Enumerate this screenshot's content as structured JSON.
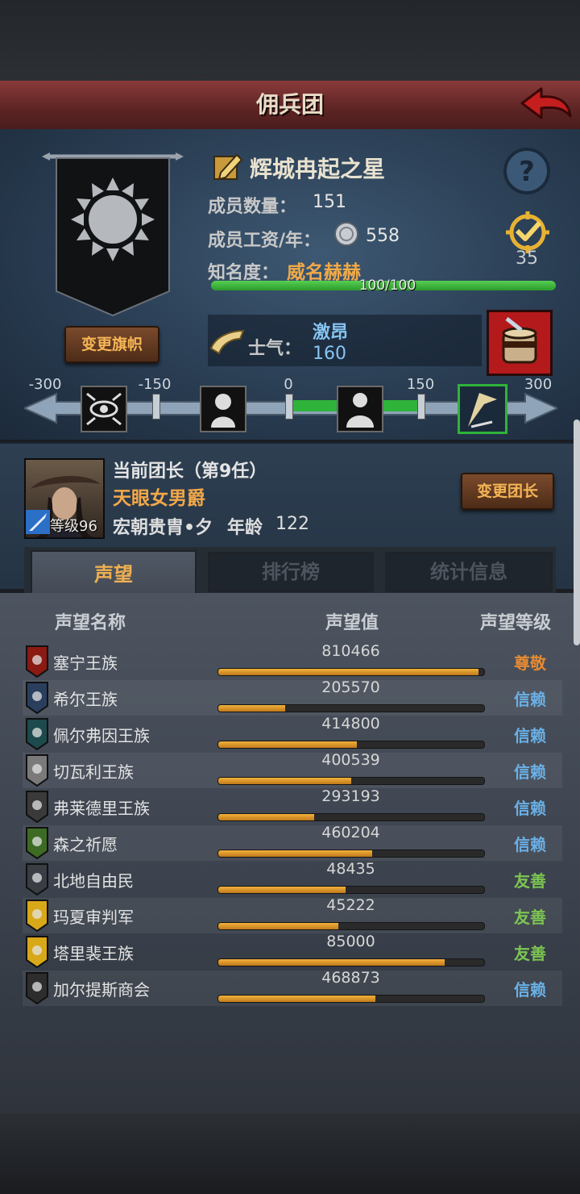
{
  "header": {
    "title": "佣兵团"
  },
  "company": {
    "name": "辉城冉起之星",
    "members_label": "成员数量：",
    "members_value": "151",
    "wage_label": "成员工资/年：",
    "wage_value": "558",
    "fame_label": "知名度：",
    "fame_value": "威名赫赫",
    "fame_progress_text": "100/100",
    "fame_progress": 1.0,
    "badge_value": "35",
    "change_flag_label": "变更旗帜"
  },
  "morale": {
    "label": "士气：",
    "state": "激昂",
    "value": "160",
    "ticks": [
      "-300",
      "-150",
      "0",
      "150",
      "300"
    ],
    "min": -300,
    "max": 300,
    "current": 160
  },
  "leader": {
    "title": "当前团长（第9任）",
    "name": "天眼女男爵",
    "level_label": "等级96",
    "origin": "宏朝贵胄•夕",
    "age_label": "年龄",
    "age_value": "122",
    "change_leader_label": "变更团长"
  },
  "tabs": [
    {
      "label": "声望",
      "active": true
    },
    {
      "label": "排行榜",
      "active": false
    },
    {
      "label": "统计信息",
      "active": false
    }
  ],
  "table": {
    "headers": [
      "声望名称",
      "声望值",
      "声望等级"
    ],
    "rows": [
      {
        "name": "塞宁王族",
        "value": "810466",
        "level": "尊敬",
        "progress": 0.98,
        "level_color": "#e48a34",
        "crest_color": "#8a1a12"
      },
      {
        "name": "希尔王族",
        "value": "205570",
        "level": "信赖",
        "progress": 0.25,
        "level_color": "#6ab0e6",
        "crest_color": "#2a3f5e"
      },
      {
        "name": "佩尔弗因王族",
        "value": "414800",
        "level": "信赖",
        "progress": 0.52,
        "level_color": "#6ab0e6",
        "crest_color": "#1d4a4c"
      },
      {
        "name": "切瓦利王族",
        "value": "400539",
        "level": "信赖",
        "progress": 0.5,
        "level_color": "#6ab0e6",
        "crest_color": "#7a7a7a"
      },
      {
        "name": "弗莱德里王族",
        "value": "293193",
        "level": "信赖",
        "progress": 0.36,
        "level_color": "#6ab0e6",
        "crest_color": "#3a3a3a"
      },
      {
        "name": "森之祈愿",
        "value": "460204",
        "level": "信赖",
        "progress": 0.58,
        "level_color": "#6ab0e6",
        "crest_color": "#3d6b24"
      },
      {
        "name": "北地自由民",
        "value": "48435",
        "level": "友善",
        "progress": 0.48,
        "level_color": "#7cc452",
        "crest_color": "#3a3d44"
      },
      {
        "name": "玛夏审判军",
        "value": "45222",
        "level": "友善",
        "progress": 0.45,
        "level_color": "#7cc452",
        "crest_color": "#d8a818"
      },
      {
        "name": "塔里裴王族",
        "value": "85000",
        "level": "友善",
        "progress": 0.85,
        "level_color": "#7cc452",
        "crest_color": "#d8a818"
      },
      {
        "name": "加尔提斯商会",
        "value": "468873",
        "level": "信赖",
        "progress": 0.59,
        "level_color": "#6ab0e6",
        "crest_color": "#2d2d2d"
      }
    ]
  }
}
